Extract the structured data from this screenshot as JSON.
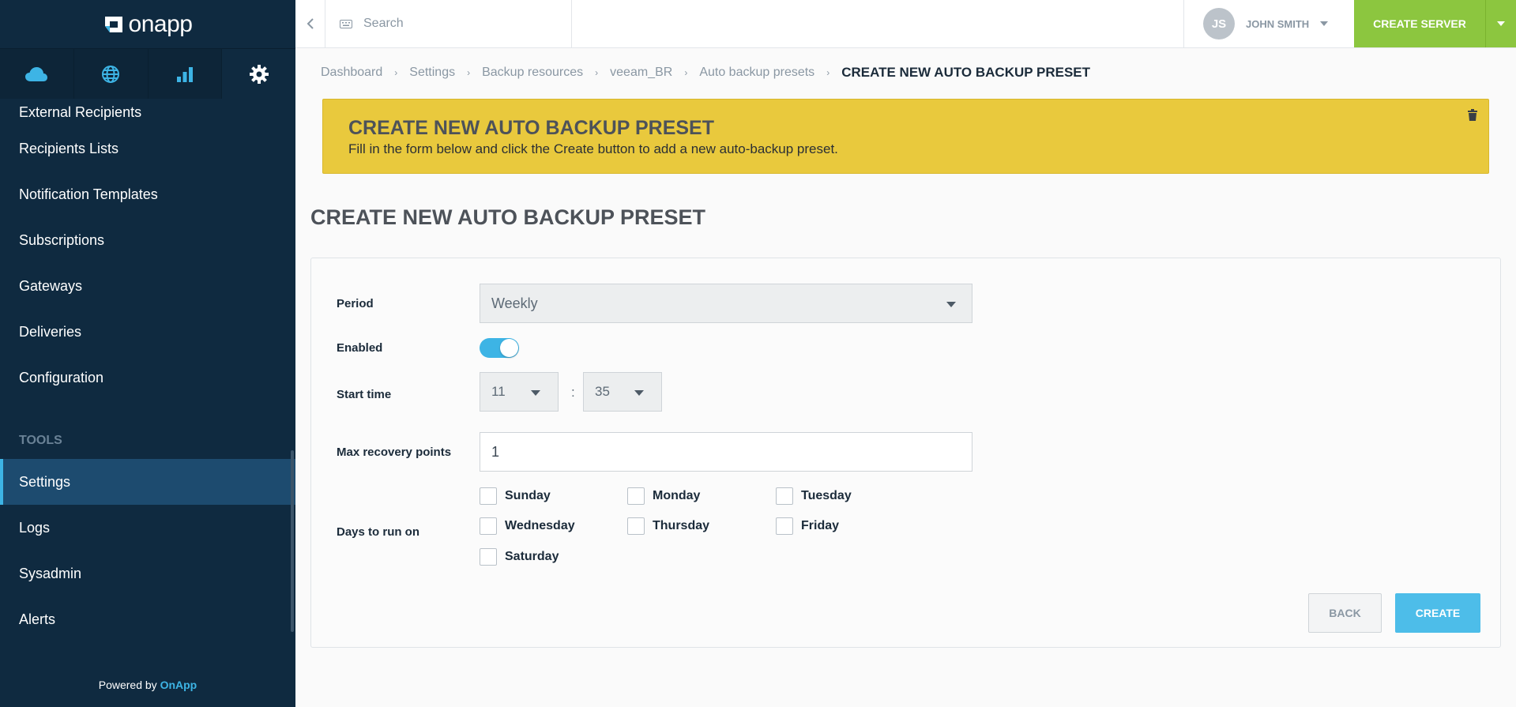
{
  "brand": {
    "logo_text": "onapp"
  },
  "sidebar": {
    "menu_items": [
      {
        "label": "External Recipients"
      },
      {
        "label": "Recipients Lists"
      },
      {
        "label": "Notification Templates"
      },
      {
        "label": "Subscriptions"
      },
      {
        "label": "Gateways"
      },
      {
        "label": "Deliveries"
      },
      {
        "label": "Configuration"
      }
    ],
    "tools_heading": "TOOLS",
    "tool_items": [
      {
        "label": "Settings",
        "active": true
      },
      {
        "label": "Logs"
      },
      {
        "label": "Sysadmin"
      },
      {
        "label": "Alerts"
      }
    ],
    "powered_prefix": "Powered by",
    "powered_brand": "OnApp"
  },
  "topbar": {
    "search_placeholder": "Search",
    "user_initials": "JS",
    "user_name": "JOHN SMITH",
    "create_server_label": "CREATE SERVER"
  },
  "breadcrumb": {
    "items": [
      "Dashboard",
      "Settings",
      "Backup resources",
      "veeam_BR",
      "Auto backup presets"
    ],
    "current": "CREATE NEW AUTO BACKUP PRESET"
  },
  "banner": {
    "title": "CREATE NEW AUTO BACKUP PRESET",
    "text": "Fill in the form below and click the Create button to add a new auto-backup preset."
  },
  "page_title": "CREATE NEW AUTO BACKUP PRESET",
  "form": {
    "period_label": "Period",
    "period_value": "Weekly",
    "enabled_label": "Enabled",
    "enabled_value": true,
    "start_time_label": "Start time",
    "start_hour": "11",
    "start_minute": "35",
    "time_separator": ":",
    "max_points_label": "Max recovery points",
    "max_points_value": "1",
    "days_label": "Days to run on",
    "days": [
      {
        "label": "Sunday",
        "checked": false
      },
      {
        "label": "Monday",
        "checked": false
      },
      {
        "label": "Tuesday",
        "checked": false
      },
      {
        "label": "Wednesday",
        "checked": false
      },
      {
        "label": "Thursday",
        "checked": false
      },
      {
        "label": "Friday",
        "checked": false
      },
      {
        "label": "Saturday",
        "checked": false
      }
    ],
    "back_label": "BACK",
    "create_label": "CREATE"
  },
  "colors": {
    "sidebar_bg": "#0f2a40",
    "accent_blue": "#3db4e5",
    "create_server_green": "#8cc63f",
    "banner_yellow": "#e9c93d"
  }
}
